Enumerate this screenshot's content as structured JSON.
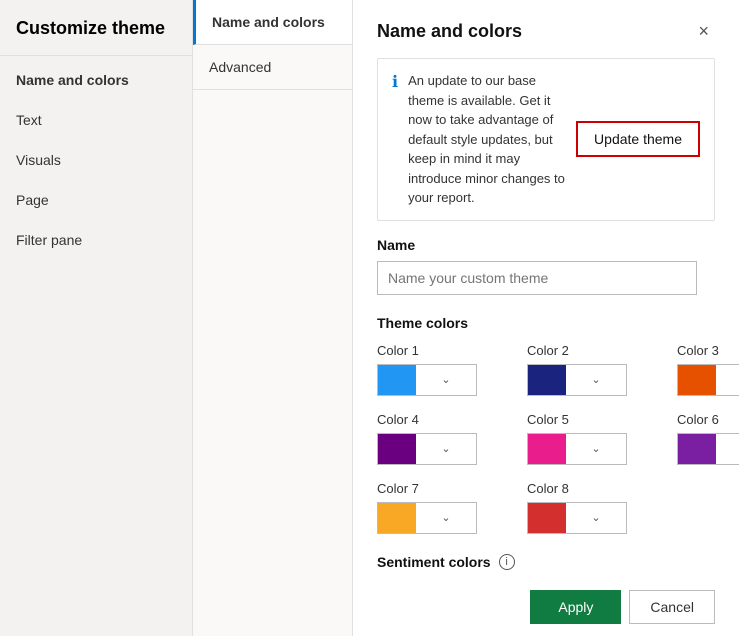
{
  "sidebar": {
    "title": "Customize theme",
    "items": [
      {
        "id": "name-and-colors",
        "label": "Name and colors",
        "active": true
      },
      {
        "id": "text",
        "label": "Text",
        "active": false
      },
      {
        "id": "visuals",
        "label": "Visuals",
        "active": false
      },
      {
        "id": "page",
        "label": "Page",
        "active": false
      },
      {
        "id": "filter-pane",
        "label": "Filter pane",
        "active": false
      }
    ]
  },
  "tabs": [
    {
      "id": "name-and-colors",
      "label": "Name and colors",
      "active": true
    },
    {
      "id": "advanced",
      "label": "Advanced",
      "active": false
    }
  ],
  "main": {
    "title": "Name and colors",
    "close_label": "×",
    "info_text": "An update to our base theme is available. Get it now to take advantage of default style updates, but keep in mind it may introduce minor changes to your report.",
    "update_theme_label": "Update theme",
    "name_section_label": "Name",
    "name_placeholder": "Name your custom theme",
    "theme_colors_label": "Theme colors",
    "colors": [
      {
        "label": "Color 1",
        "color": "#2196f3"
      },
      {
        "label": "Color 2",
        "color": "#1a237e"
      },
      {
        "label": "Color 3",
        "color": "#e65100"
      },
      {
        "label": "Color 4",
        "color": "#6a0080"
      },
      {
        "label": "Color 5",
        "color": "#e91e8c"
      },
      {
        "label": "Color 6",
        "color": "#7b1fa2"
      },
      {
        "label": "Color 7",
        "color": "#f9a825"
      },
      {
        "label": "Color 8",
        "color": "#d32f2f"
      }
    ],
    "sentiment_label": "Sentiment colors",
    "apply_label": "Apply",
    "cancel_label": "Cancel"
  }
}
